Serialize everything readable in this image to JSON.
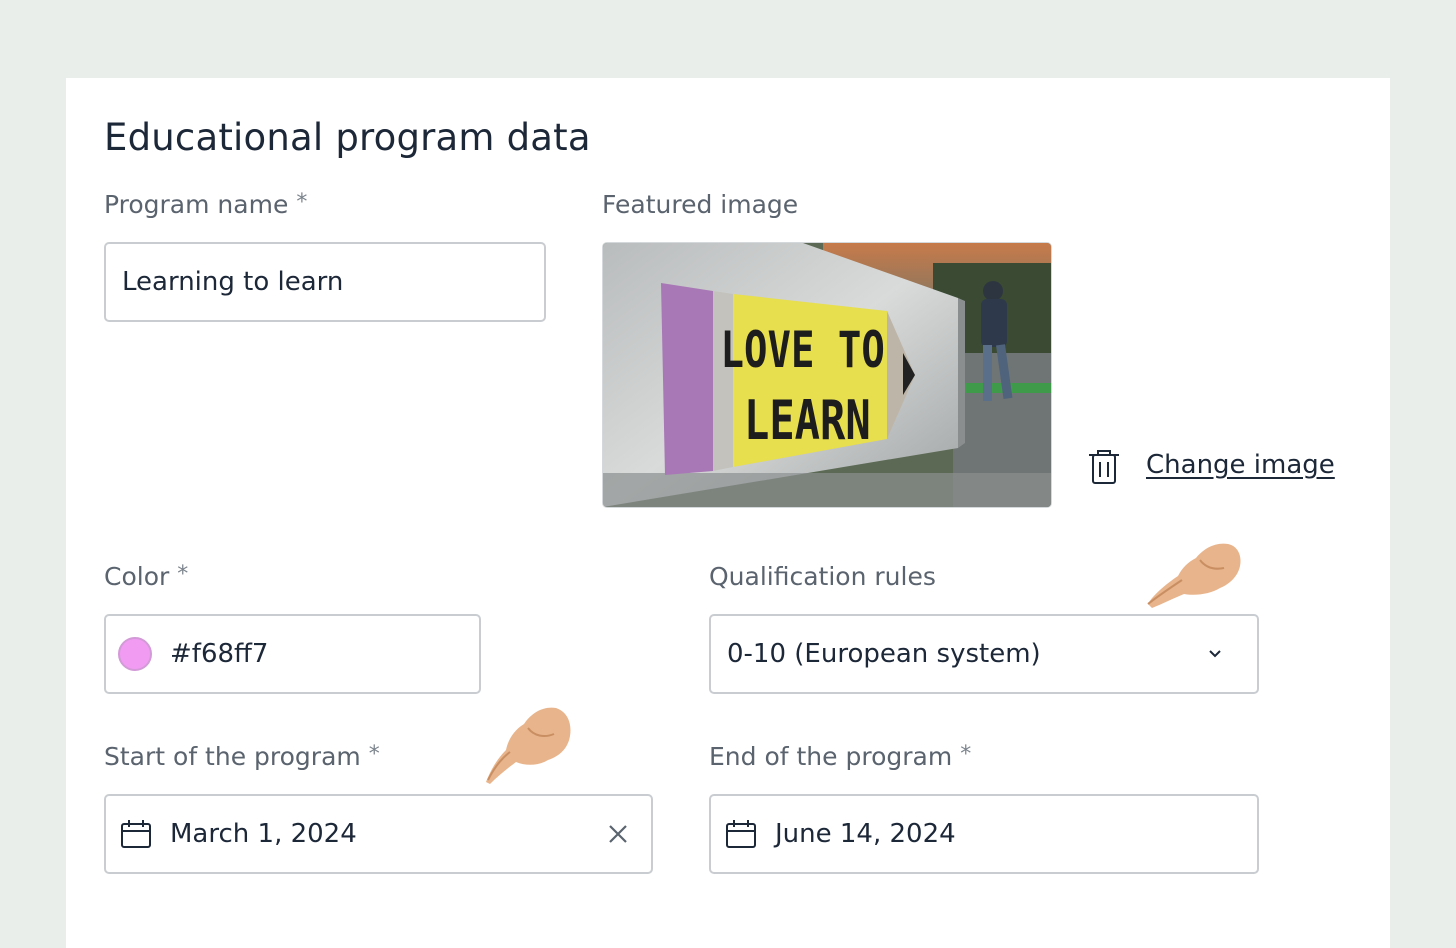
{
  "form": {
    "title": "Educational program data",
    "required_mark": "*",
    "program_name": {
      "label": "Program name",
      "value": "Learning to learn"
    },
    "featured_image": {
      "label": "Featured image",
      "sign_line1": "LOVE TO",
      "sign_line2": "LEARN",
      "change_label": "Change image",
      "delete_icon": "trash-icon"
    },
    "color": {
      "label": "Color",
      "value": "#f68ff7",
      "swatch": "#f19bf2"
    },
    "qualification_rules": {
      "label": "Qualification rules",
      "value": "0-10 (European system)",
      "icon": "chevron-down-icon"
    },
    "start": {
      "label": "Start of the program",
      "value": "March 1, 2024",
      "icon": "calendar-icon",
      "clear_icon": "close-icon"
    },
    "end": {
      "label": "End of the program",
      "value": "June 14, 2024",
      "icon": "calendar-icon"
    }
  }
}
